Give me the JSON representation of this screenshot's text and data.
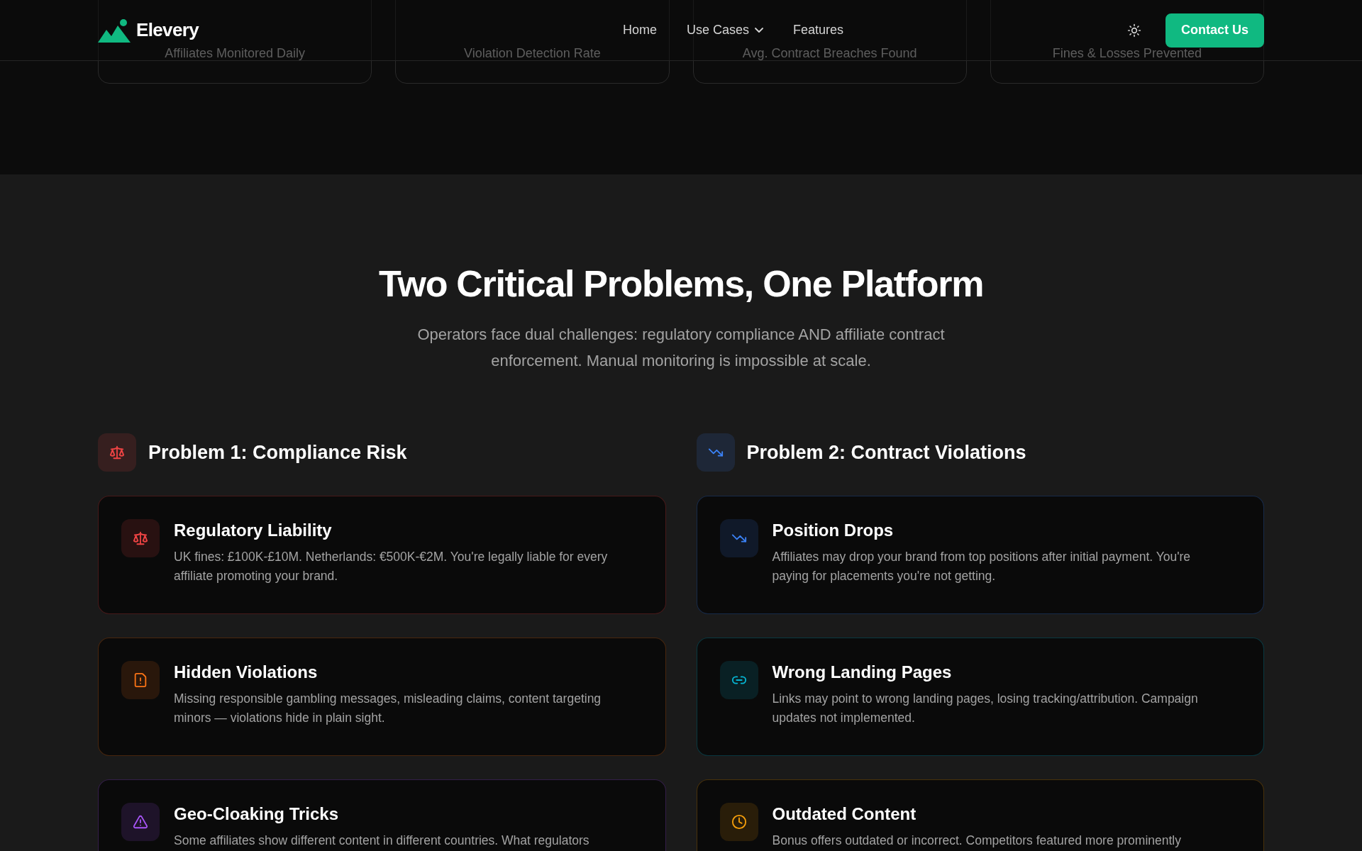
{
  "header": {
    "brand": "Elevery",
    "nav": [
      {
        "label": "Home",
        "dropdown": false
      },
      {
        "label": "Use Cases",
        "dropdown": true
      },
      {
        "label": "Features",
        "dropdown": false
      }
    ],
    "cta": "Contact Us"
  },
  "stats": [
    "Affiliates Monitored Daily",
    "Violation Detection Rate",
    "Avg. Contract Breaches Found",
    "Fines & Losses Prevented"
  ],
  "section": {
    "title": "Two Critical Problems, One Platform",
    "subtitle": "Operators face dual challenges: regulatory compliance AND affiliate contract enforcement. Manual monitoring is impossible at scale."
  },
  "problems": [
    {
      "title": "Problem 1: Compliance Risk",
      "kind": "scale",
      "color": "#ef4444",
      "cards": [
        {
          "title": "Regulatory Liability",
          "text": "UK fines: £100K-£10M. Netherlands: €500K-€2M. You're legally liable for every affiliate promoting your brand.",
          "kind": "scale",
          "color": "#ef4444"
        },
        {
          "title": "Hidden Violations",
          "text": "Missing responsible gambling messages, misleading claims, content targeting minors — violations hide in plain sight.",
          "kind": "file-alert",
          "color": "#f97316"
        },
        {
          "title": "Geo-Cloaking Tricks",
          "text": "Some affiliates show different content in different countries. What regulators",
          "kind": "warning",
          "color": "#a855f7"
        }
      ]
    },
    {
      "title": "Problem 2: Contract Violations",
      "kind": "trend-down",
      "color": "#3b82f6",
      "cards": [
        {
          "title": "Position Drops",
          "text": "Affiliates may drop your brand from top positions after initial payment. You're paying for placements you're not getting.",
          "kind": "trend-down",
          "color": "#3b82f6"
        },
        {
          "title": "Wrong Landing Pages",
          "text": "Links may point to wrong landing pages, losing tracking/attribution. Campaign updates not implemented.",
          "kind": "link",
          "color": "#06b6d4"
        },
        {
          "title": "Outdated Content",
          "text": "Bonus offers outdated or incorrect. Competitors featured more prominently",
          "kind": "clock",
          "color": "#f59e0b"
        }
      ]
    }
  ]
}
